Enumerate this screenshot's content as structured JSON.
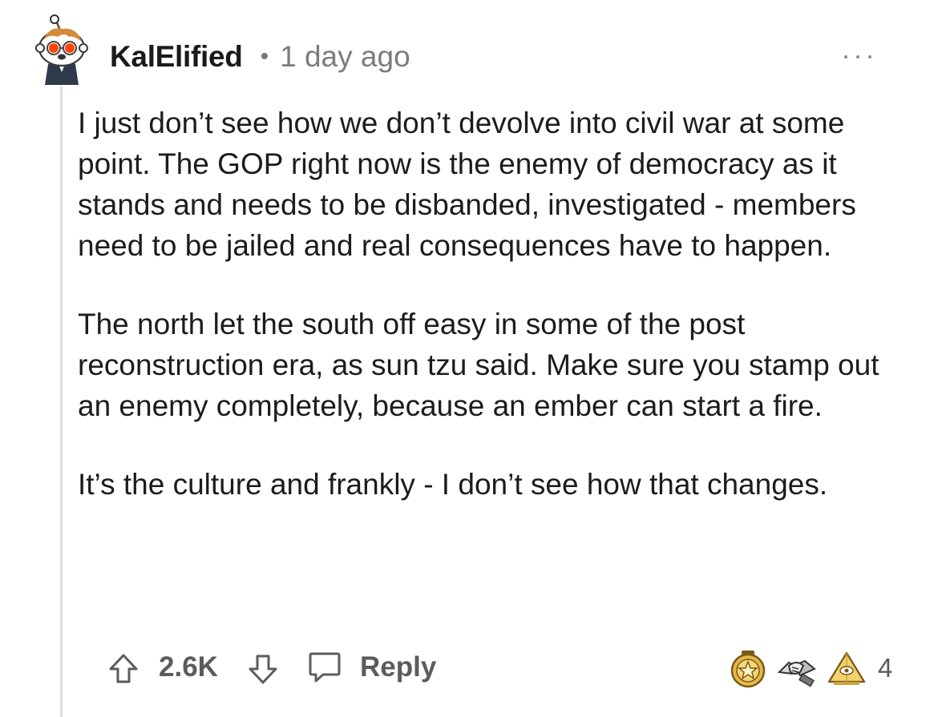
{
  "comment": {
    "username": "KalElified",
    "separator": "•",
    "time_ago": "1 day ago",
    "paragraphs": [
      "I just don’t see how we don’t devolve into civil war at some point. The GOP right now is the enemy of democracy as it stands and needs to be disbanded, investigated - members need to be jailed and real consequences have to happen.",
      "The north let the south off easy in some of the post reconstruction era, as sun tzu said. Make sure you stamp out an enemy completely, because an ember can start a fire.",
      "It’s the culture and frankly - I don’t see how that changes."
    ]
  },
  "actions": {
    "upvote_icon": "arrow-up-icon",
    "score": "2.6K",
    "downvote_icon": "arrow-down-icon",
    "reply_icon": "speech-bubble-icon",
    "reply_label": "Reply",
    "more_icon": "more-dots-icon"
  },
  "awards": {
    "items": [
      "star-medal-award-icon",
      "handshake-award-icon",
      "pyramid-award-icon"
    ],
    "count": "4"
  },
  "colors": {
    "text": "#1c1c1e",
    "meta": "#7c7c7c",
    "action": "#5c5c5c",
    "thread_line": "#dedede"
  }
}
